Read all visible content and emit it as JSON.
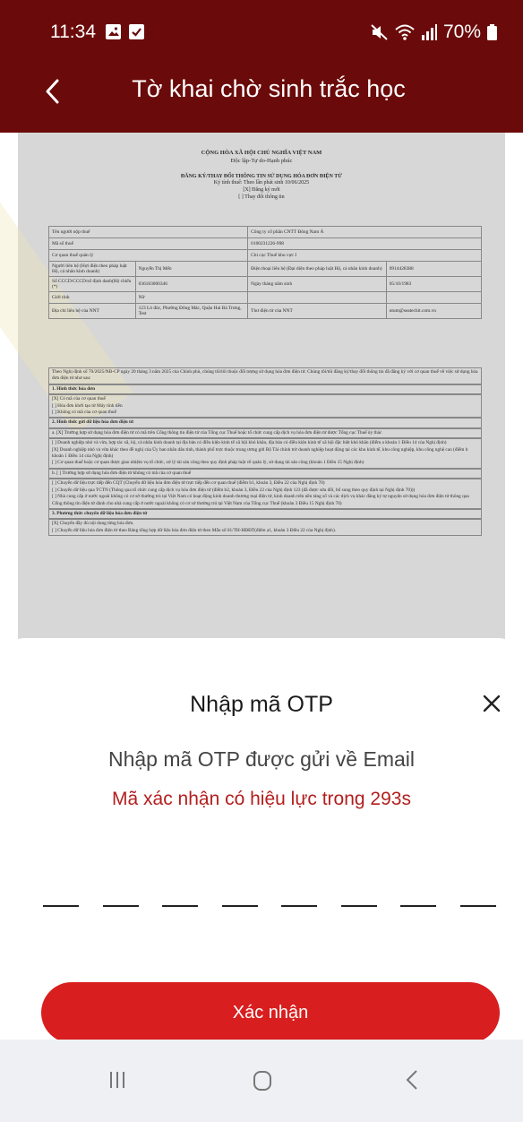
{
  "status_bar": {
    "time": "11:34",
    "battery": "70%",
    "icons": [
      "gallery-icon",
      "check-icon",
      "mute-icon",
      "wifi-icon",
      "signal-icon",
      "battery-icon"
    ]
  },
  "header": {
    "title": "Tờ khai chờ sinh trắc học",
    "back_icon": "chevron-left-icon",
    "background": "#6b0a0a"
  },
  "document": {
    "heading_1": "CỘNG HÒA XÃ HỘI CHỦ NGHĨA VIỆT NAM",
    "heading_2": "Độc lập-Tự do-Hạnh phúc",
    "form_title": "ĐĂNG KÝ/THAY ĐỔI THÔNG TIN SỬ DỤNG HÓA ĐƠN ĐIỆN TỬ",
    "form_subtitle_1": "Ký tính thuế: Theo lần phát sinh 10/06/2025",
    "form_subtitle_2": "[X] Đăng ký mới",
    "form_subtitle_3": "[ ] Thay đổi thông tin",
    "table": [
      [
        "Tên người nộp thuế",
        "",
        "Công ty cổ phần CNTT Đông Nam Á",
        ""
      ],
      [
        "Mã số thuế",
        "",
        "0100231226-998",
        ""
      ],
      [
        "Cơ quan thuế quản lý",
        "",
        "Chi cục Thuế khu vực I",
        ""
      ],
      [
        "Người liên hệ (Hợi điện theo pháp luật Hộ, cá nhân kinh doanh)",
        "Nguyễn Thị Mến",
        "Điện thoại liên hệ (Đại diện theo pháp luật Hộ, cá nhân kinh doanh)",
        "0914428388"
      ],
      [
        "Số CCCD/CCCD/số định danh(Hộ chiếu (*)",
        "036183000346",
        "Ngày tháng năm sinh",
        "05/10/1983"
      ],
      [
        "Giới tính",
        "Nữ",
        "",
        ""
      ],
      [
        "Địa chỉ liên hệ của NNT",
        "123 Lò đúc, Phường Đông Mác, Quận Hai Bà Trưng, Test",
        "Thư điện tử của NNT",
        "ntum@seatechit.com.vn"
      ]
    ],
    "intro": "Theo Nghị định số 70/2025/NĐ-CP ngày 20 tháng 3 năm 2025 của Chính phủ, chúng tôi/tôi thuộc đối tượng sử dụng hóa đơn điện tử. Chúng tôi/tôi đăng ký/thay đổi thông tin đã đăng ký với cơ quan thuế về việc sử dụng hóa đơn điện tử như sau:",
    "section_1": "1. Hình thức hóa đơn",
    "section_1_items": [
      "[X] Có mã của cơ quan thuế",
      "[ ] Hóa đơn khởi tạo từ Máy tính tiền",
      "[ ] Không có mã của cơ quan thuế"
    ],
    "section_2": "2. Hình thức gửi dữ liệu hóa đơn điện tử",
    "section_2a": "a. [X] Trường hợp sử dụng hóa đơn điện tử có mã trên Cổng thông tin điện tử của Tổng cục Thuế hoặc tổ chức cung cấp dịch vụ hóa đơn điện tử được Tổng cục Thuế ủy thác",
    "section_2a_items": [
      "[ ] Doanh nghiệp nhỏ và vừa, hợp tác xã, hộ, cá nhân kinh doanh tại địa bàn có điều kiện kinh tế xã hội khó khăn, địa bàn có điều kiện kinh tế xã hội đặc biệt khó khăn (điểm a khoản 1 Điều 14 của Nghị định)",
      "[X] Doanh nghiệp nhỏ và vừa khác theo đề nghị của Ủy ban nhân dân tỉnh, thành phố trực thuộc trung ương gửi Bộ Tài chính trừ doanh nghiệp hoạt động tại các khu kinh tế, khu công nghiệp, khu công nghệ cao (điểm b khoản 1 Điều 14 của Nghị định)",
      "[ ] Cơ quan thuế hoặc cơ quan được giao nhiệm vụ tổ chức, xử lý tài sản công theo quy định pháp luật về quản lý, sử dụng tài sản công (khoản 1 Điều 15 Nghị định)"
    ],
    "section_2b": "b. [ ] Trường hợp sử dụng hóa đơn điện tử không có mã của cơ quan thuế",
    "section_2b_items": [
      "[ ] Chuyển dữ liệu trực tiếp đến CQT (Chuyển dữ liệu hóa đơn điện tử trực tiếp đến cơ quan thuế (điểm b1, khoản 3, Điều 22 của Nghị định 70)",
      "[ ] Chuyển dữ liệu qua TCTN (Thông qua tổ chức cung cấp dịch vụ hóa đơn điện tử (điểm b2, khoản 3, Điều 22 của Nghị định 123 (đã được sửa đổi, bổ sung theo quy định tại Nghị định 70)))",
      "[ ] Nhà cung cấp ở nước ngoài không có cơ sở thường trú tại Việt Nam có hoạt động kinh doanh thương mại điện tử, kinh doanh trên nền tảng số và các dịch vụ khác đăng ký tự nguyện sử dụng hóa đơn điện tử thông qua Cổng thông tin điện tử dành cho nhà cung cấp ở nước ngoài không có cơ sở thường trú tại Việt Nam của Tổng cục Thuế (khoản 3 Điều 15 Nghị định 70)"
    ],
    "section_3": "3. Phương thức chuyển dữ liệu hóa đơn điện tử",
    "section_3_items": [
      "[X] Chuyển đầy đủ nội dung từng hóa đơn.",
      "[ ] Chuyển dữ liệu hóa đơn điện tử theo Bảng tổng hợp dữ liệu hóa đơn điện tử theo Mẫu số 01/TH-HĐĐT(điểm a1, khoản 3 Điều 22 của Nghị định)."
    ]
  },
  "otp_sheet": {
    "title": "Nhập mã OTP",
    "close_icon": "close-icon",
    "description": "Nhập mã OTP được gửi về Email",
    "timer_text": "Mã xác nhận có hiệu lực trong 293s",
    "slot_count": 8,
    "otp_values": [
      "",
      "",
      "",
      "",
      "",
      "",
      "",
      ""
    ],
    "confirm_label": "Xác nhận",
    "accent": "#d81e1e",
    "timer_color": "#b31e1e"
  },
  "nav_bar": {
    "icons": [
      "recent-apps-icon",
      "home-icon",
      "back-icon"
    ]
  }
}
